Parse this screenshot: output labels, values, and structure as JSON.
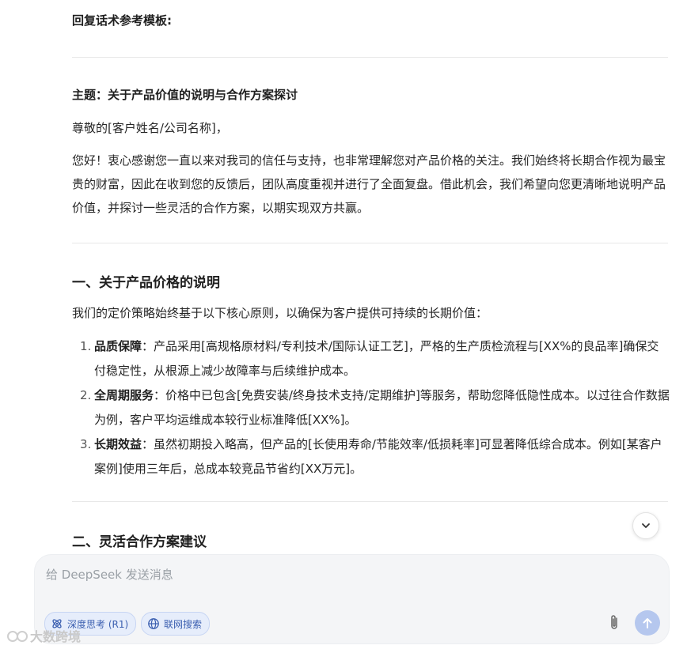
{
  "template_title": "回复话术参考模板:",
  "subject": "主题：关于产品价值的说明与合作方案探讨",
  "greeting": "尊敬的[客户姓名/公司名称]，",
  "intro": "您好！衷心感谢您一直以来对我司的信任与支持，也非常理解您对产品价格的关注。我们始终将长期合作视为最宝贵的财富，因此在收到您的反馈后，团队高度重视并进行了全面复盘。借此机会，我们希望向您更清晰地说明产品价值，并探讨一些灵活的合作方案，以期实现双方共赢。",
  "section1": {
    "heading": "一、关于产品价格的说明",
    "lead": "我们的定价策略始终基于以下核心原则，以确保为客户提供可持续的长期价值：",
    "items": [
      {
        "num": "1.",
        "label": "品质保障",
        "text": "：产品采用[高规格原材料/专利技术/国际认证工艺]，严格的生产质检流程与[XX%的良品率]确保交付稳定性，从根源上减少故障率与后续维护成本。"
      },
      {
        "num": "2.",
        "label": "全周期服务",
        "text": "：价格中已包含[免费安装/终身技术支持/定期维护]等服务，帮助您降低隐性成本。以过往合作数据为例，客户平均运维成本较行业标准降低[XX%]。"
      },
      {
        "num": "3.",
        "label": "长期效益",
        "text": "：虽然初期投入略高，但产品的[长使用寿命/节能效率/低损耗率]可显著降低综合成本。例如[某客户案例]使用三年后，总成本较竞品节省约[XX万元]。"
      }
    ]
  },
  "section2": {
    "heading": "二、灵活合作方案建议"
  },
  "input": {
    "placeholder": "给 DeepSeek 发送消息"
  },
  "buttons": {
    "deep_think": "深度思考 (R1)",
    "web_search": "联网搜索"
  },
  "watermark": "大数跨境",
  "colors": {
    "accent": "#3b5fb0",
    "pill_bg": "#e6edfb",
    "send_bg": "#b5c7ee"
  }
}
